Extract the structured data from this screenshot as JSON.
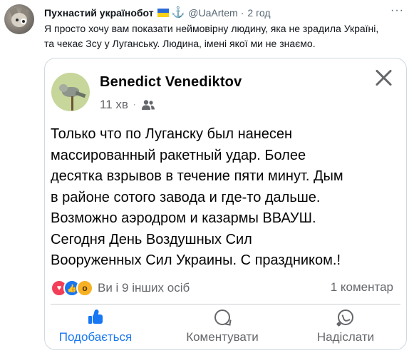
{
  "tweet": {
    "author_name": "Пухнастий українобот",
    "handle": "@UaArtem",
    "separator": "·",
    "time": "2 год",
    "more_label": "···",
    "text_lines": [
      "Я просто хочу вам показати неймовірну людину, яка не зрадила Україні,",
      "та чекає Зсу у Луганську. Людина,  імені якої ми не знаємо."
    ]
  },
  "fb_post": {
    "author_name": "Benedict Venediktov",
    "time": "11 хв",
    "meta_separator": "·",
    "audience_icon": "friends-icon",
    "text_lines": [
      "Только что по Луганску был нанесен",
      "массированный ракетный удар. Более",
      "десятка взрывов в течение пяти минут. Дым",
      "в районе сотого завода и где-то дальше.",
      "Возможно аэродром и казармы ВВАУШ.",
      "Сегодня День Воздушных Сил",
      "Вооруженных Сил Украины. С праздником.!"
    ],
    "reactions_text": "Ви і 9 інших осіб",
    "comments_text": "1 коментар",
    "actions": {
      "like": "Подобається",
      "comment": "Коментувати",
      "share": "Надіслати"
    }
  },
  "colors": {
    "fb_blue": "#1877f2",
    "twitter_blue": "#1d9bf0",
    "muted": "#65676b"
  }
}
